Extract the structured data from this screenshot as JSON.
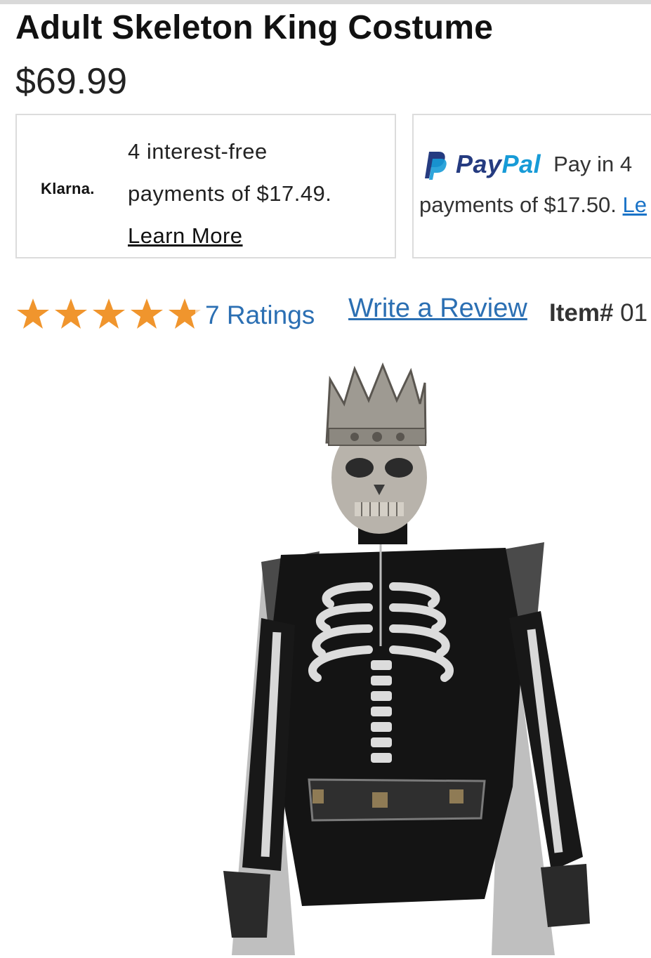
{
  "product": {
    "title": "Adult Skeleton King Costume",
    "price": "$69.99",
    "image_alt": "Skeleton King costume with crown skull mask, black bodysuit with skeleton print, belt, gloves and cape"
  },
  "klarna": {
    "logo": "Klarna.",
    "line1": "4 interest-free",
    "line2": "payments of $17.49.",
    "learn_more": "Learn More"
  },
  "paypal": {
    "logo_pay": "Pay",
    "logo_pal": "Pal",
    "pay_in": "Pay in 4",
    "payments": "payments of $17.50.",
    "learn_link": "Le"
  },
  "ratings": {
    "stars": 4.7,
    "stars_max": 5,
    "count_label": "7 Ratings",
    "write_review": "Write a Review",
    "item_label": "Item#",
    "item_number": "01"
  },
  "colors": {
    "star": "#f0952d",
    "link": "#2b6fb3",
    "paypal_dark": "#253b80",
    "paypal_light": "#179bd7"
  }
}
